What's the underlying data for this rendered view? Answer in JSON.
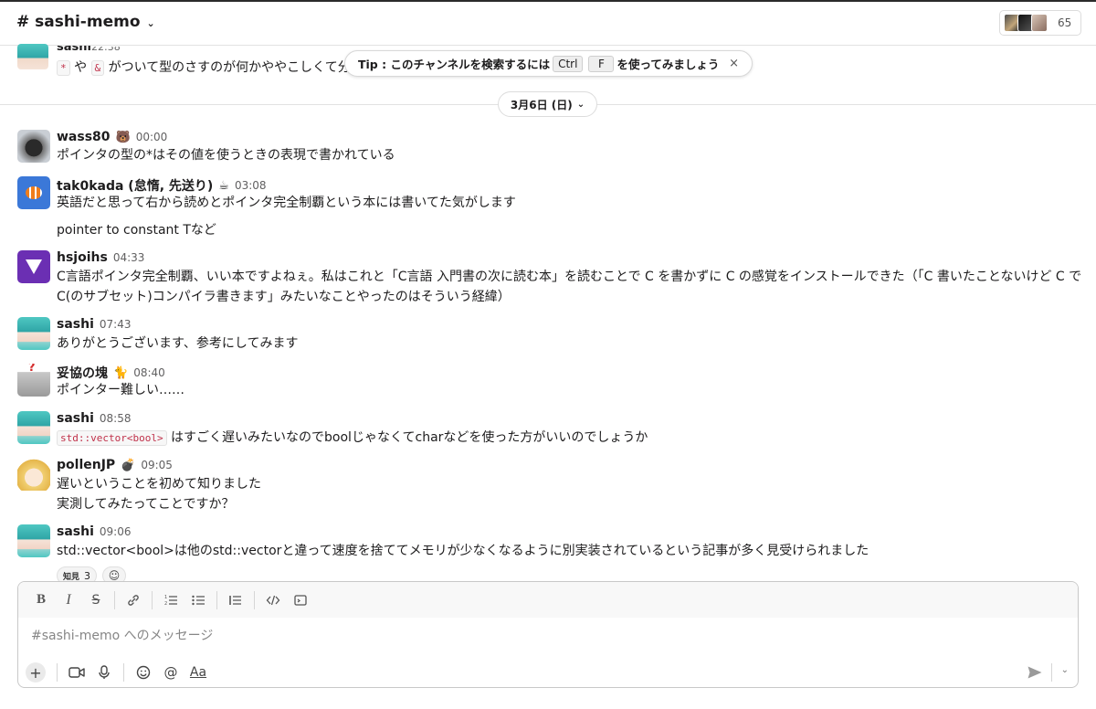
{
  "header": {
    "channel_title": "# sashi-memo",
    "member_count": "65"
  },
  "partial_message": {
    "name": "sashi",
    "time": "22:38",
    "code1": "*",
    "mid": " や ",
    "code2": "&",
    "text": " がついて型のさすのが何かややこしくて分..."
  },
  "tip": {
    "prefix": "Tip : このチャンネルを検索するには",
    "key1": "Ctrl",
    "key2": "F",
    "suffix": "を使ってみましょう",
    "close": "×"
  },
  "date_divider": {
    "label": "3月6日 (日)"
  },
  "messages": [
    {
      "name": "wass80",
      "status": "🐻",
      "time": "00:00",
      "lines": [
        "ポインタの型の*はその値を使うときの表現で書かれている"
      ]
    },
    {
      "name": "tak0kada (怠惰, 先送り)",
      "status": "☕",
      "time": "03:08",
      "lines": [
        "英語だと思って右から読めとポインタ完全制覇という本には書いてた気がします",
        "pointer to constant Tなど"
      ]
    },
    {
      "name": "hsjoihs",
      "status": "",
      "time": "04:33",
      "lines": [
        "C言語ポインタ完全制覇、いい本ですよねぇ。私はこれと「C言語 入門書の次に読む本」を読むことで C を書かずに C の感覚をインストールできた（「C 書いたことないけど C で",
        "C(のサブセット)コンパイラ書きます」みたいなことやったのはそういう経緯）"
      ]
    },
    {
      "name": "sashi",
      "status": "",
      "time": "07:43",
      "lines": [
        "ありがとうございます、参考にしてみます"
      ]
    },
    {
      "name": "妥協の塊",
      "status": "🐈",
      "time": "08:40",
      "lines": [
        "ポインター難しい……"
      ]
    },
    {
      "name": "sashi",
      "status": "",
      "time": "08:58",
      "code": "std::vector<bool>",
      "lines": [
        " はすごく遅いみたいなのでboolじゃなくてcharなどを使った方がいいのでしょうか"
      ]
    },
    {
      "name": "pollenJP",
      "status": "💣",
      "time": "09:05",
      "lines": [
        "遅いということを初めて知りました",
        "実測してみたってことですか？"
      ]
    },
    {
      "name": "sashi",
      "status": "",
      "time": "09:06",
      "lines": [
        "std::vector<bool>は他のstd::vectorと違って速度を捨ててメモリが少なくなるように別実装されているという記事が多く見受けられました"
      ]
    }
  ],
  "reactions": [
    {
      "emoji": "知見",
      "count": "3"
    }
  ],
  "composer": {
    "placeholder": "#sashi-memo へのメッセージ",
    "aa_label": "Aa"
  }
}
